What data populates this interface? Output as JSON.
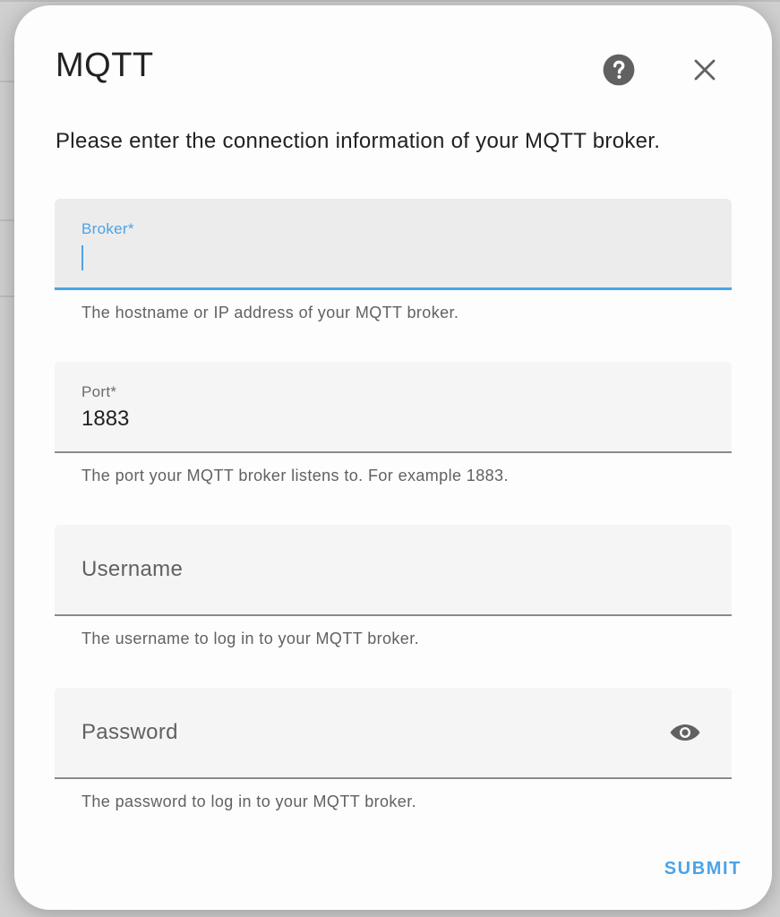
{
  "dialog": {
    "title": "MQTT",
    "description": "Please enter the connection information of your MQTT broker.",
    "help_icon": "help-circle-icon",
    "close_icon": "close-icon"
  },
  "fields": [
    {
      "label": "Broker*",
      "value": "",
      "helper": "The hostname or IP address of your MQTT broker.",
      "focused": true
    },
    {
      "label": "Port*",
      "value": "1883",
      "helper": "The port your MQTT broker listens to. For example 1883."
    },
    {
      "label": "Username",
      "value": "",
      "helper": "The username to log in to your MQTT broker."
    },
    {
      "label": "Password",
      "value": "",
      "helper": "The password to log in to your MQTT broker.",
      "trailing_icon": "eye-icon"
    }
  ],
  "actions": {
    "submit_label": "SUBMIT"
  },
  "colors": {
    "accent": "#4aa3e8",
    "text": "#212121",
    "secondary_text": "#616161",
    "field_background": "#f5f5f5"
  }
}
